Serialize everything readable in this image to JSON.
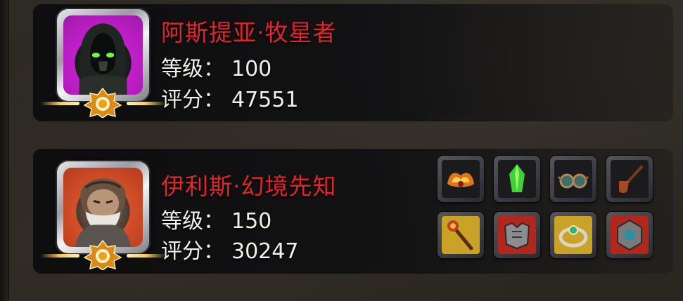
{
  "players": [
    {
      "name": "阿斯提亚·牧星者",
      "level_label": "等级：",
      "level": "100",
      "score_label": "评分：",
      "score": "47551"
    },
    {
      "name": "伊利斯·幻境先知",
      "level_label": "等级：",
      "level": "150",
      "score_label": "评分：",
      "score": "30247"
    }
  ],
  "equipment": [
    {
      "icon": "flame-crown-icon"
    },
    {
      "icon": "green-crystal-icon"
    },
    {
      "icon": "goggles-icon"
    },
    {
      "icon": "pipe-icon"
    },
    {
      "icon": "staff-icon"
    },
    {
      "icon": "armor-icon"
    },
    {
      "icon": "ring-icon"
    },
    {
      "icon": "amulet-icon"
    }
  ],
  "colors": {
    "name": "#e0262d",
    "frame_purple": "#c21fcc",
    "frame_orange": "#d4502a",
    "equip_gold": "#c9a227",
    "equip_red": "#b3261c",
    "equip_dark": "#1b1b1e"
  }
}
